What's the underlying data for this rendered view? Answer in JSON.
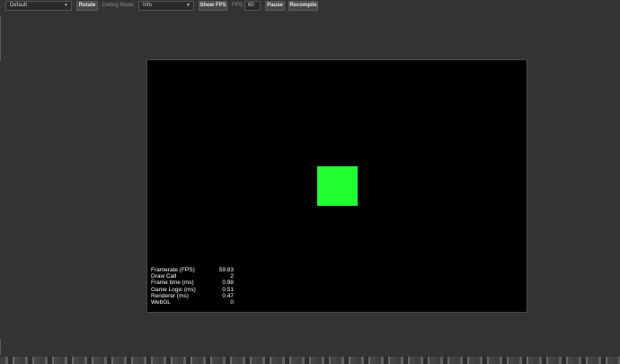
{
  "toolbar": {
    "preset_select": "Default",
    "rotate_label": "Rotate",
    "debug_mode_label": "Debug Mode:",
    "debug_mode_value": "Info",
    "show_fps_label": "Show FPS",
    "fps_label": "FPS:",
    "fps_value": "60",
    "pause_label": "Pause",
    "recompile_label": "Recompile"
  },
  "stats": [
    {
      "label": "Framerate (FPS)",
      "value": "59.83"
    },
    {
      "label": "Draw Call",
      "value": "2"
    },
    {
      "label": "Frame time (ms)",
      "value": "0.98"
    },
    {
      "label": "Game Logic (ms)",
      "value": "0.51"
    },
    {
      "label": "Renderer (ms)",
      "value": "0.47"
    },
    {
      "label": "WebGL",
      "value": "0"
    }
  ],
  "colors": {
    "background": "#333333",
    "canvas": "#000000",
    "sprite": "#22ff33"
  }
}
